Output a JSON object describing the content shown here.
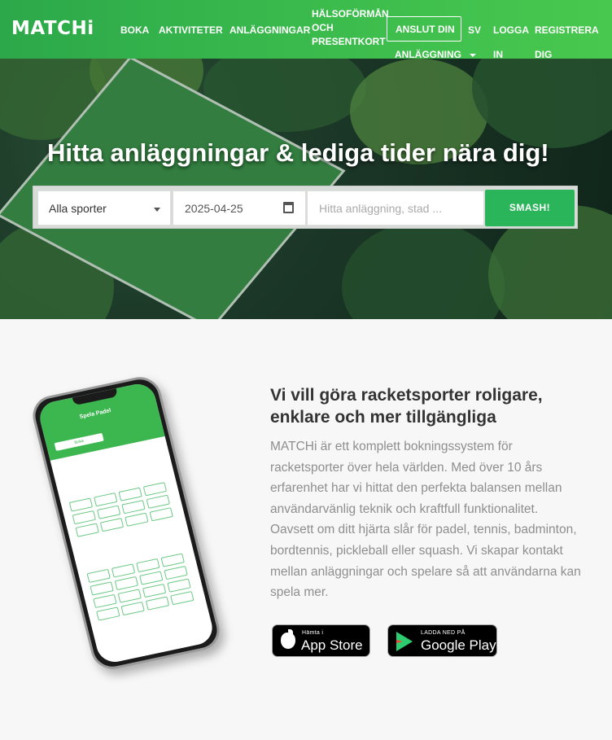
{
  "brand": {
    "logo_text": "MATCHi"
  },
  "nav": {
    "boka": "BOKA",
    "aktiviteter": "AKTIVITETER",
    "anlaggningar": "ANLÄGGNINGAR",
    "halso": "HÄLSOFÖRMÅN OCH PRESENTKORT",
    "anslut_line1": "ANSLUT DIN",
    "anslut_line2": "ANLÄGGNING",
    "lang": "SV",
    "logga_line1": "LOGGA",
    "logga_line2": "IN",
    "reg_line1": "REGISTRERA",
    "reg_line2": "DIG"
  },
  "hero": {
    "title": "Hitta anläggningar & lediga tider nära dig!",
    "sport_select": "Alla sporter",
    "date_value": "2025-04-25",
    "search_placeholder": "Hitta anläggning, stad ...",
    "search_button": "SMASH!"
  },
  "phone": {
    "app_title": "Spela Padel",
    "tab_label": "Boka"
  },
  "content": {
    "headline": "Vi vill göra racketsporter roligare, enklare och mer tillgängliga",
    "description": "MATCHi är ett komplett bokningssystem för racketsporter över hela världen. Med över 10 års erfarenhet har vi hittat den perfekta balansen mellan användarvänlig teknik och kraftfull funktionalitet. Oavsett om ditt hjärta slår för padel, tennis, badminton, bordtennis, pickleball eller squash. Vi skapar kontakt mellan anläggningar och spelare så att användarna kan spela mer."
  },
  "badges": {
    "apple_small": "Hämta i",
    "apple_big": "App Store",
    "google_small": "LADDA NED PÅ",
    "google_big": "Google Play"
  },
  "colors": {
    "brand_green": "#3ab84c",
    "button_green": "#2bb55a"
  }
}
